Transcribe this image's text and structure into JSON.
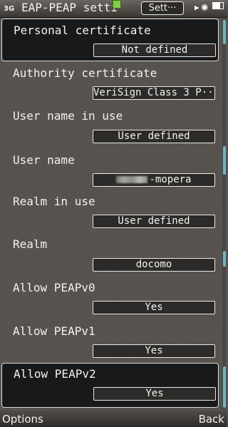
{
  "status_bar": {
    "network": "3G",
    "title": "EAP-PEAP setti",
    "menu_pill": "Sett···"
  },
  "settings": [
    {
      "label": "Personal certificate",
      "value": "Not defined"
    },
    {
      "label": "Authority certificate",
      "value": "VeriSign Class 3 P···"
    },
    {
      "label": "User name in use",
      "value": "User defined"
    },
    {
      "label": "User name",
      "value": "-mopera"
    },
    {
      "label": "Realm in use",
      "value": "User defined"
    },
    {
      "label": "Realm",
      "value": "docomo"
    },
    {
      "label": "Allow PEAPv0",
      "value": "Yes"
    },
    {
      "label": "Allow PEAPv1",
      "value": "Yes"
    },
    {
      "label": "Allow PEAPv2",
      "value": "Yes"
    }
  ],
  "softkeys": {
    "left": "Options",
    "right": "Back"
  },
  "colors": {
    "accent": "#6fb3c4",
    "background": "#57524d",
    "selected_bg": "#17191b"
  }
}
